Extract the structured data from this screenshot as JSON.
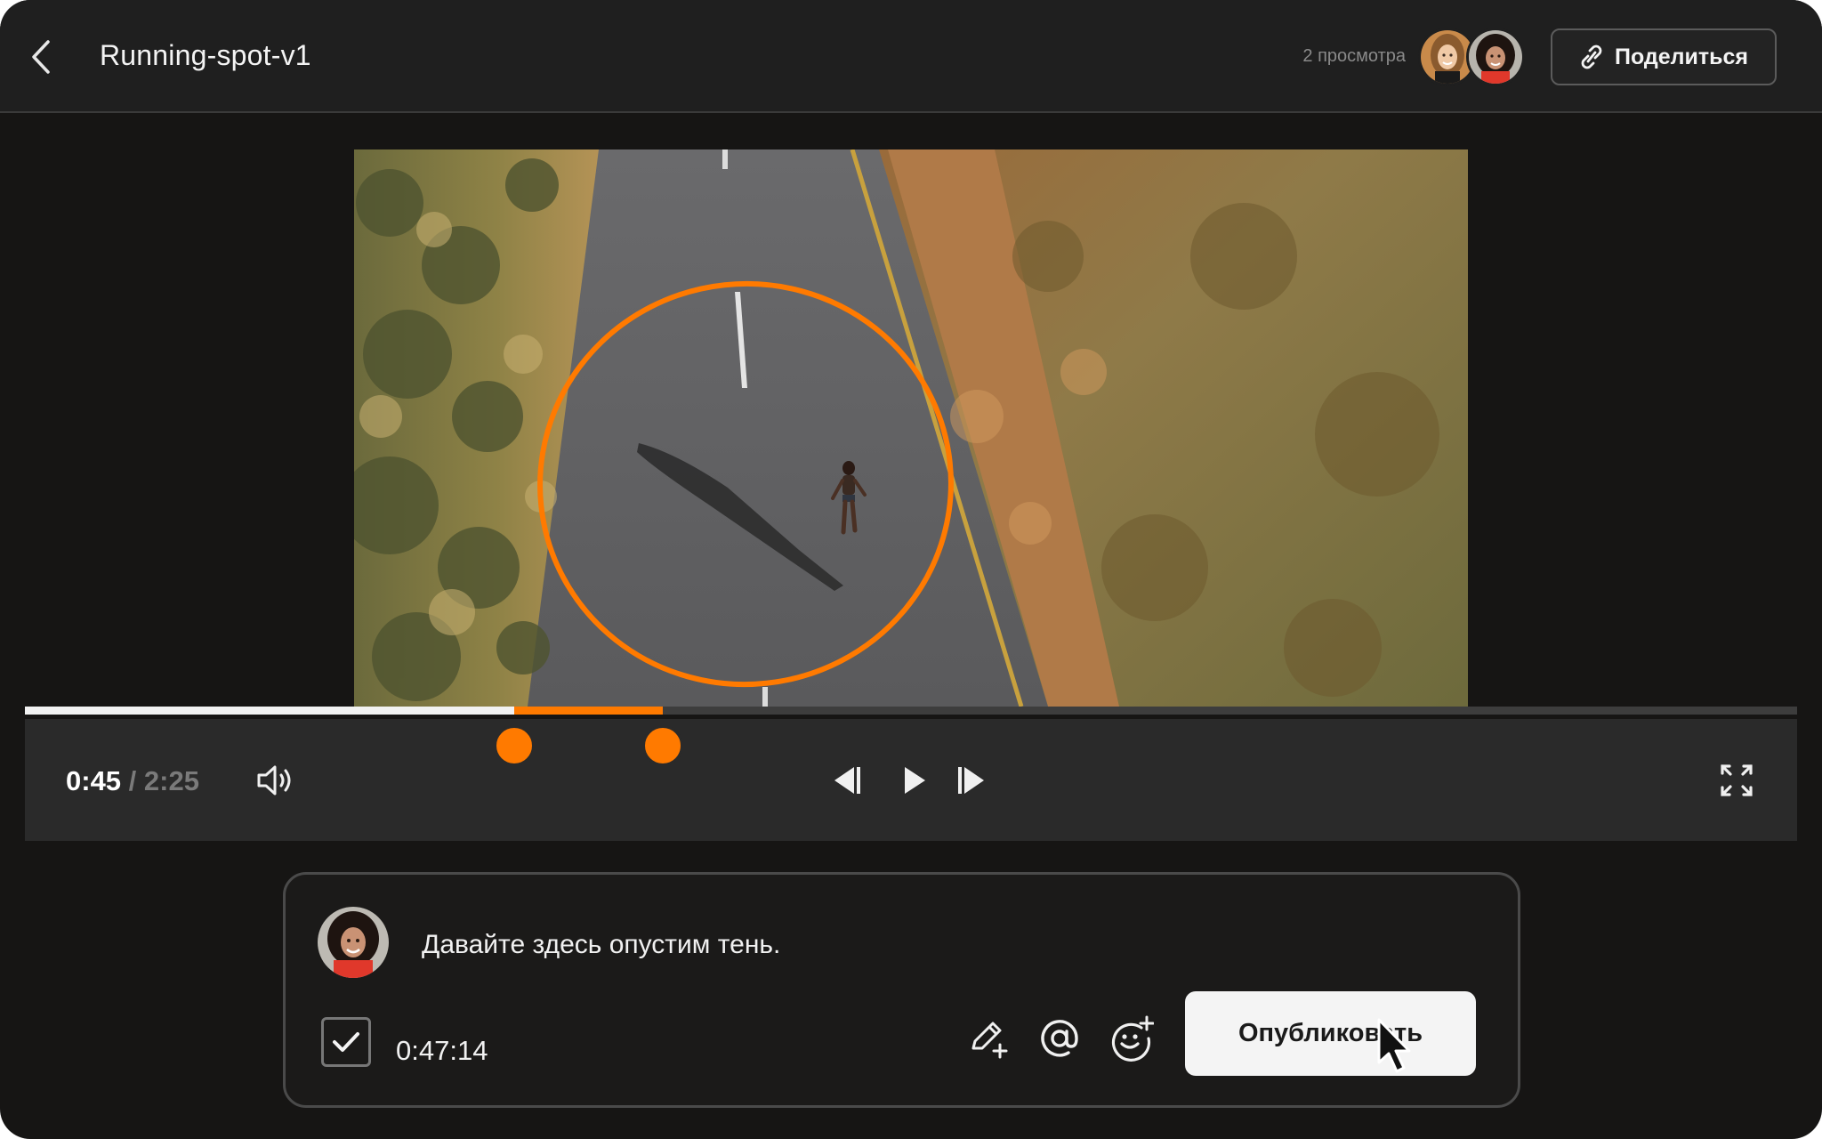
{
  "header": {
    "title": "Running-spot-v1",
    "views_label": "2 просмотра",
    "share_label": "Поделиться"
  },
  "player": {
    "current_time": "0:45",
    "separator": " / ",
    "duration": "2:25",
    "played_fraction": 0.276,
    "range_start_fraction": 0.276,
    "range_end_fraction": 0.36
  },
  "comment": {
    "text": "Давайте здесь опустим тень.",
    "timestamp": "0:47:14",
    "publish_label": "Опубликовать",
    "checked": true
  },
  "colors": {
    "accent": "#ff7a00",
    "background": "#161514",
    "surface": "#2a2a2a"
  },
  "icons": {
    "back": "chevron-left-icon",
    "share": "link-icon",
    "volume": "volume-icon",
    "prev": "skip-back-icon",
    "play": "play-icon",
    "next": "skip-forward-icon",
    "fullscreen": "fullscreen-icon",
    "draw": "pencil-plus-icon",
    "mention": "at-sign-icon",
    "emoji": "emoji-add-icon"
  }
}
